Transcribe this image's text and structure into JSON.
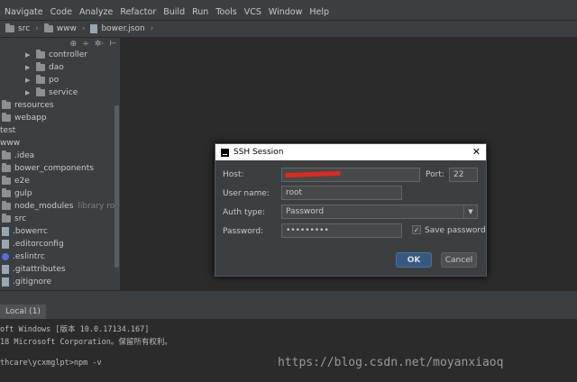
{
  "menu": [
    "Navigate",
    "Code",
    "Analyze",
    "Refactor",
    "Build",
    "Run",
    "Tools",
    "VCS",
    "Window",
    "Help"
  ],
  "breadcrumbs": [
    "src",
    "www",
    "bower.json"
  ],
  "project_toolbar": [
    "⊕",
    "÷",
    "✲·",
    "⊢"
  ],
  "tree": [
    {
      "label": "controller",
      "hint": ""
    },
    {
      "label": "dao",
      "hint": ""
    },
    {
      "label": "po",
      "hint": ""
    },
    {
      "label": "service",
      "hint": ""
    },
    {
      "label": "resources",
      "hint": ""
    },
    {
      "label": "webapp",
      "hint": ""
    },
    {
      "label": "test",
      "hint": ""
    },
    {
      "label": "www",
      "hint": ""
    },
    {
      "label": ".idea",
      "hint": ""
    },
    {
      "label": "bower_components",
      "hint": ""
    },
    {
      "label": "e2e",
      "hint": ""
    },
    {
      "label": "gulp",
      "hint": ""
    },
    {
      "label": "node_modules",
      "hint": "library root"
    },
    {
      "label": "src",
      "hint": ""
    },
    {
      "label": ".bowerrc",
      "hint": ""
    },
    {
      "label": ".editorconfig",
      "hint": ""
    },
    {
      "label": ".eslintrc",
      "hint": ""
    },
    {
      "label": ".gitattributes",
      "hint": ""
    },
    {
      "label": ".gitignore",
      "hint": ""
    }
  ],
  "terminal": {
    "tab": "Local (1)",
    "lines": [
      "oft Windows [版本 10.0.17134.167]",
      "18 Microsoft Corporation。保留所有权利。",
      "",
      "thcare\\ycxmglpt>npm -v"
    ]
  },
  "dialog": {
    "title": "SSH Session",
    "close": "✕",
    "host_label": "Host:",
    "host_value": "",
    "port_label": "Port:",
    "port_value": "22",
    "user_label": "User name:",
    "user_value": "root",
    "auth_label": "Auth type:",
    "auth_value": "Password",
    "password_label": "Password:",
    "password_value": "•••••••••",
    "save_password_label": "Save password",
    "save_password_checked": true,
    "ok_label": "OK",
    "cancel_label": "Cancel"
  },
  "watermark": "https://blog.csdn.net/moyanxiaoq"
}
